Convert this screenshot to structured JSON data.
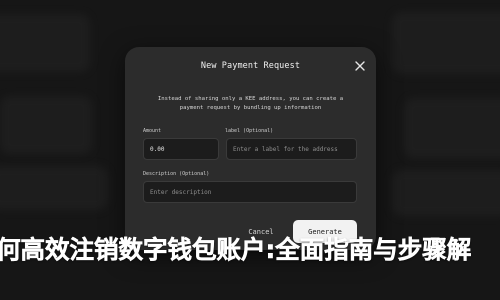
{
  "modal": {
    "title": "New Payment Request",
    "description": "Instead of sharing only a KEE address, you can create a payment request by bundling up information",
    "amount": {
      "label": "Amount",
      "value": "0.00"
    },
    "label_field": {
      "label": "label (Optional)",
      "placeholder": "Enter a label for the address"
    },
    "description_field": {
      "label": "Description (Optional)",
      "placeholder": "Enter description"
    },
    "buttons": {
      "cancel": "Cancel",
      "generate": "Generate"
    },
    "close_icon": "close-icon"
  },
  "headline": "何高效注销数字钱包账户:全面指南与步骤解",
  "colors": {
    "background": "#161616",
    "modal_background": "#2c2c2c",
    "input_background": "#1c1c1c",
    "primary_button": "#f2f2f2",
    "headline_text": "#ffffff"
  }
}
